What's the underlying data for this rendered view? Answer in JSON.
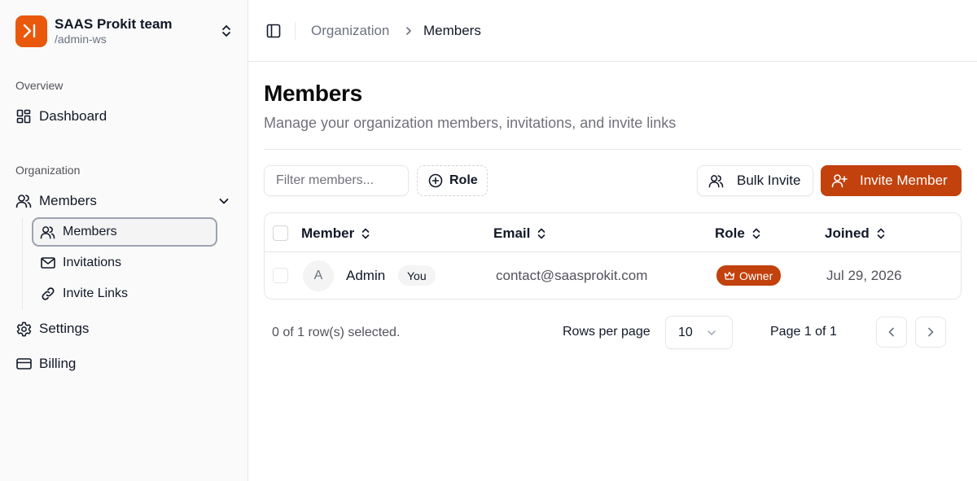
{
  "team": {
    "name": "SAAS Prokit team",
    "slug": "/admin-ws"
  },
  "sidebar": {
    "overview_label": "Overview",
    "dashboard": "Dashboard",
    "organization_label": "Organization",
    "members_group": "Members",
    "sub_items": [
      {
        "label": "Members",
        "icon": "users-icon",
        "active": true
      },
      {
        "label": "Invitations",
        "icon": "mail-icon"
      },
      {
        "label": "Invite Links",
        "icon": "link-icon"
      }
    ],
    "settings": "Settings",
    "billing": "Billing"
  },
  "breadcrumb": {
    "parent": "Organization",
    "current": "Members"
  },
  "page": {
    "title": "Members",
    "subtitle": "Manage your organization members, invitations, and invite links"
  },
  "toolbar": {
    "filter_placeholder": "Filter members...",
    "role_filter": "Role",
    "bulk_invite": "Bulk Invite",
    "invite_member": "Invite Member"
  },
  "table": {
    "columns": [
      "Member",
      "Email",
      "Role",
      "Joined"
    ],
    "rows": [
      {
        "avatar_initial": "A",
        "name": "Admin",
        "badge": "You",
        "email": "contact@saasprokit.com",
        "role": "Owner",
        "joined": "Jul 29, 2026"
      }
    ]
  },
  "footer": {
    "selected": "0 of 1 row(s) selected.",
    "rows_per_page_label": "Rows per page",
    "rows_per_page_value": "10",
    "page_info": "Page 1 of 1"
  },
  "colors": {
    "accent": "#c2410c",
    "logo": "#ea580c"
  }
}
